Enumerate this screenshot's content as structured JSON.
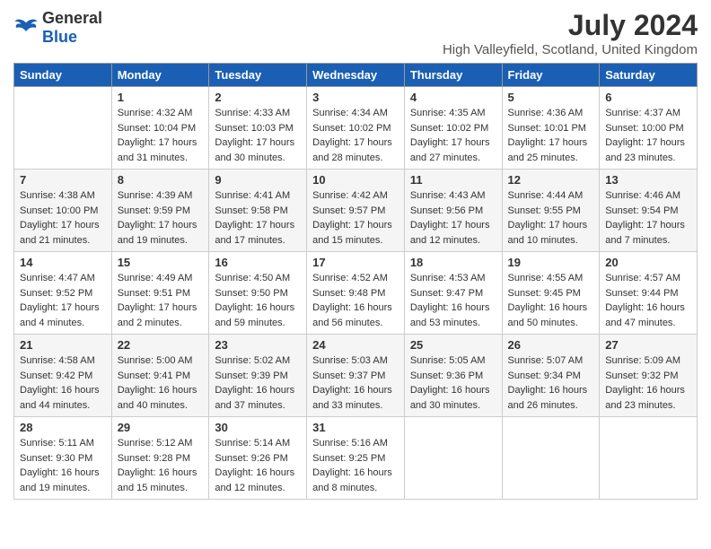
{
  "header": {
    "logo_general": "General",
    "logo_blue": "Blue",
    "title": "July 2024",
    "subtitle": "High Valleyfield, Scotland, United Kingdom"
  },
  "days_of_week": [
    "Sunday",
    "Monday",
    "Tuesday",
    "Wednesday",
    "Thursday",
    "Friday",
    "Saturday"
  ],
  "weeks": [
    [
      {
        "day": "",
        "info": ""
      },
      {
        "day": "1",
        "info": "Sunrise: 4:32 AM\nSunset: 10:04 PM\nDaylight: 17 hours\nand 31 minutes."
      },
      {
        "day": "2",
        "info": "Sunrise: 4:33 AM\nSunset: 10:03 PM\nDaylight: 17 hours\nand 30 minutes."
      },
      {
        "day": "3",
        "info": "Sunrise: 4:34 AM\nSunset: 10:02 PM\nDaylight: 17 hours\nand 28 minutes."
      },
      {
        "day": "4",
        "info": "Sunrise: 4:35 AM\nSunset: 10:02 PM\nDaylight: 17 hours\nand 27 minutes."
      },
      {
        "day": "5",
        "info": "Sunrise: 4:36 AM\nSunset: 10:01 PM\nDaylight: 17 hours\nand 25 minutes."
      },
      {
        "day": "6",
        "info": "Sunrise: 4:37 AM\nSunset: 10:00 PM\nDaylight: 17 hours\nand 23 minutes."
      }
    ],
    [
      {
        "day": "7",
        "info": "Sunrise: 4:38 AM\nSunset: 10:00 PM\nDaylight: 17 hours\nand 21 minutes."
      },
      {
        "day": "8",
        "info": "Sunrise: 4:39 AM\nSunset: 9:59 PM\nDaylight: 17 hours\nand 19 minutes."
      },
      {
        "day": "9",
        "info": "Sunrise: 4:41 AM\nSunset: 9:58 PM\nDaylight: 17 hours\nand 17 minutes."
      },
      {
        "day": "10",
        "info": "Sunrise: 4:42 AM\nSunset: 9:57 PM\nDaylight: 17 hours\nand 15 minutes."
      },
      {
        "day": "11",
        "info": "Sunrise: 4:43 AM\nSunset: 9:56 PM\nDaylight: 17 hours\nand 12 minutes."
      },
      {
        "day": "12",
        "info": "Sunrise: 4:44 AM\nSunset: 9:55 PM\nDaylight: 17 hours\nand 10 minutes."
      },
      {
        "day": "13",
        "info": "Sunrise: 4:46 AM\nSunset: 9:54 PM\nDaylight: 17 hours\nand 7 minutes."
      }
    ],
    [
      {
        "day": "14",
        "info": "Sunrise: 4:47 AM\nSunset: 9:52 PM\nDaylight: 17 hours\nand 4 minutes."
      },
      {
        "day": "15",
        "info": "Sunrise: 4:49 AM\nSunset: 9:51 PM\nDaylight: 17 hours\nand 2 minutes."
      },
      {
        "day": "16",
        "info": "Sunrise: 4:50 AM\nSunset: 9:50 PM\nDaylight: 16 hours\nand 59 minutes."
      },
      {
        "day": "17",
        "info": "Sunrise: 4:52 AM\nSunset: 9:48 PM\nDaylight: 16 hours\nand 56 minutes."
      },
      {
        "day": "18",
        "info": "Sunrise: 4:53 AM\nSunset: 9:47 PM\nDaylight: 16 hours\nand 53 minutes."
      },
      {
        "day": "19",
        "info": "Sunrise: 4:55 AM\nSunset: 9:45 PM\nDaylight: 16 hours\nand 50 minutes."
      },
      {
        "day": "20",
        "info": "Sunrise: 4:57 AM\nSunset: 9:44 PM\nDaylight: 16 hours\nand 47 minutes."
      }
    ],
    [
      {
        "day": "21",
        "info": "Sunrise: 4:58 AM\nSunset: 9:42 PM\nDaylight: 16 hours\nand 44 minutes."
      },
      {
        "day": "22",
        "info": "Sunrise: 5:00 AM\nSunset: 9:41 PM\nDaylight: 16 hours\nand 40 minutes."
      },
      {
        "day": "23",
        "info": "Sunrise: 5:02 AM\nSunset: 9:39 PM\nDaylight: 16 hours\nand 37 minutes."
      },
      {
        "day": "24",
        "info": "Sunrise: 5:03 AM\nSunset: 9:37 PM\nDaylight: 16 hours\nand 33 minutes."
      },
      {
        "day": "25",
        "info": "Sunrise: 5:05 AM\nSunset: 9:36 PM\nDaylight: 16 hours\nand 30 minutes."
      },
      {
        "day": "26",
        "info": "Sunrise: 5:07 AM\nSunset: 9:34 PM\nDaylight: 16 hours\nand 26 minutes."
      },
      {
        "day": "27",
        "info": "Sunrise: 5:09 AM\nSunset: 9:32 PM\nDaylight: 16 hours\nand 23 minutes."
      }
    ],
    [
      {
        "day": "28",
        "info": "Sunrise: 5:11 AM\nSunset: 9:30 PM\nDaylight: 16 hours\nand 19 minutes."
      },
      {
        "day": "29",
        "info": "Sunrise: 5:12 AM\nSunset: 9:28 PM\nDaylight: 16 hours\nand 15 minutes."
      },
      {
        "day": "30",
        "info": "Sunrise: 5:14 AM\nSunset: 9:26 PM\nDaylight: 16 hours\nand 12 minutes."
      },
      {
        "day": "31",
        "info": "Sunrise: 5:16 AM\nSunset: 9:25 PM\nDaylight: 16 hours\nand 8 minutes."
      },
      {
        "day": "",
        "info": ""
      },
      {
        "day": "",
        "info": ""
      },
      {
        "day": "",
        "info": ""
      }
    ]
  ]
}
